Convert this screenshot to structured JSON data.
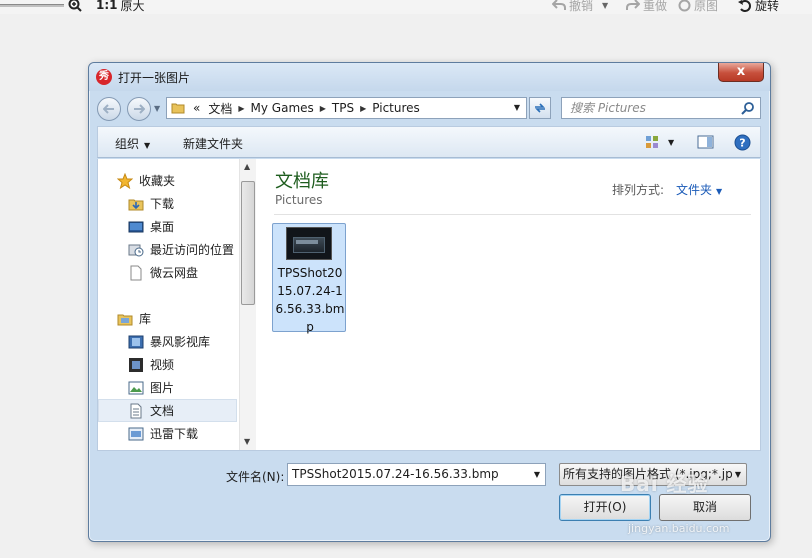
{
  "toolbar": {
    "zoom_label": "原大",
    "zoom_prefix": "1:1",
    "undo": "撤销",
    "redo": "重做",
    "original": "原图",
    "rotate": "旋转"
  },
  "dialog": {
    "title": "打开一张图片",
    "close": "x",
    "breadcrumb": {
      "overflow": "«",
      "items": [
        "文档",
        "My Games",
        "TPS",
        "Pictures"
      ]
    },
    "search_placeholder": "搜索 Pictures",
    "commands": {
      "organize": "组织",
      "new_folder": "新建文件夹"
    },
    "nav": {
      "favorites": [
        "收藏夹",
        "下载",
        "桌面",
        "最近访问的位置",
        "微云网盘"
      ],
      "libraries": [
        "库",
        "暴风影视库",
        "视频",
        "图片",
        "文档",
        "迅雷下载"
      ]
    },
    "library": {
      "title": "文档库",
      "subtitle": "Pictures",
      "arrange_label": "排列方式:",
      "arrange_value": "文件夹"
    },
    "files": [
      {
        "name": "TPSShot2015.07.24-16.56.33.bmp"
      }
    ],
    "filename_label": "文件名(N):",
    "filename_value": "TPSShot2015.07.24-16.56.33.bmp",
    "filetype_value": "所有支持的图片格式 (*.jpg;*.jp",
    "open_button": "打开(O)",
    "cancel_button": "取消"
  },
  "watermark": {
    "brand": "Bai 经验",
    "url": "jingyan.baidu.com"
  }
}
